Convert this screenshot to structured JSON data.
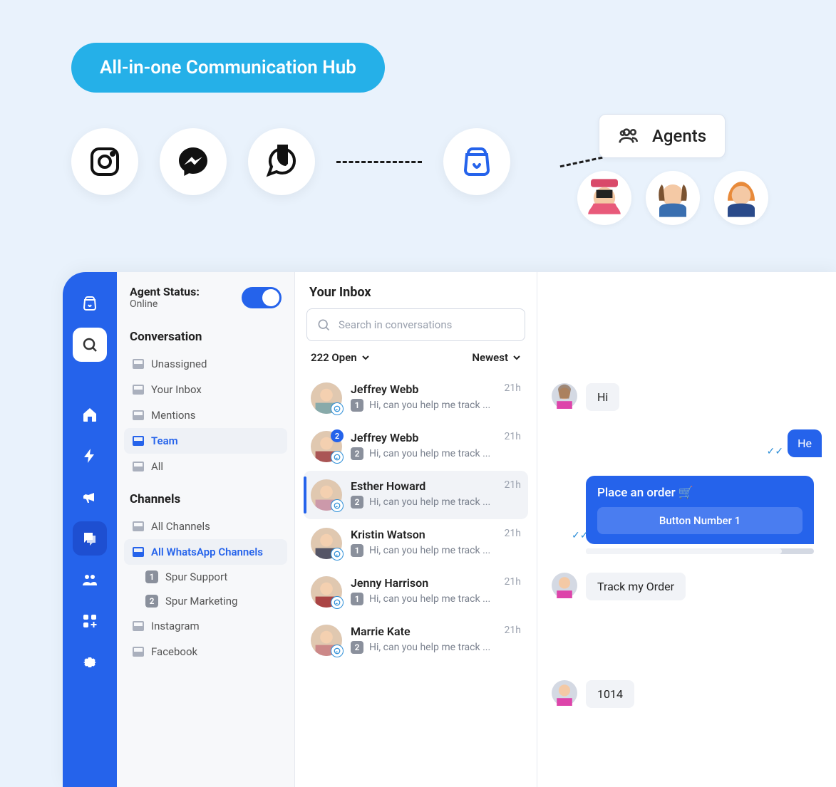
{
  "hero": {
    "pill_label": "All-in-one Communication Hub",
    "agents_label": "Agents"
  },
  "sidebar": {
    "status_title": "Agent Status:",
    "status_value": "Online",
    "conversation_header": "Conversation",
    "conversation_items": [
      {
        "label": "Unassigned"
      },
      {
        "label": "Your Inbox"
      },
      {
        "label": "Mentions"
      },
      {
        "label": "Team"
      },
      {
        "label": "All"
      }
    ],
    "channels_header": "Channels",
    "channels": {
      "all_label": "All Channels",
      "whatsapp_label": "All WhatsApp Channels",
      "whatsapp_sub": [
        {
          "badge": "1",
          "label": "Spur Support"
        },
        {
          "badge": "2",
          "label": "Spur Marketing"
        }
      ],
      "instagram_label": "Instagram",
      "facebook_label": "Facebook"
    }
  },
  "inbox": {
    "header": "Your Inbox",
    "search_placeholder": "Search in conversations",
    "open_count_label": "222 Open",
    "sort_label": "Newest",
    "conversations": [
      {
        "name": "Jeffrey Webb",
        "time": "21h",
        "badge": "1",
        "preview": "Hi, can you help me track ...",
        "count_badge": ""
      },
      {
        "name": "Jeffrey Webb",
        "time": "21h",
        "badge": "2",
        "preview": "Hi, can you help me track ...",
        "count_badge": "2"
      },
      {
        "name": "Esther Howard",
        "time": "21h",
        "badge": "2",
        "preview": "Hi, can you help me track ...",
        "count_badge": ""
      },
      {
        "name": "Kristin Watson",
        "time": "21h",
        "badge": "1",
        "preview": "Hi, can you help me track ...",
        "count_badge": ""
      },
      {
        "name": "Jenny Harrison",
        "time": "21h",
        "badge": "1",
        "preview": "Hi, can you help me track ...",
        "count_badge": ""
      },
      {
        "name": "Marrie Kate",
        "time": "21h",
        "badge": "2",
        "preview": "Hi, can you help me track ...",
        "count_badge": ""
      }
    ]
  },
  "chat": {
    "msg1": "Hi",
    "msg_out": "He",
    "card_title": "Place an order 🛒",
    "card_button": "Button Number 1",
    "msg2": "Track my Order",
    "msg3": "1014"
  },
  "colors": {
    "primary": "#2563EB",
    "cyan": "#25B0E8"
  }
}
